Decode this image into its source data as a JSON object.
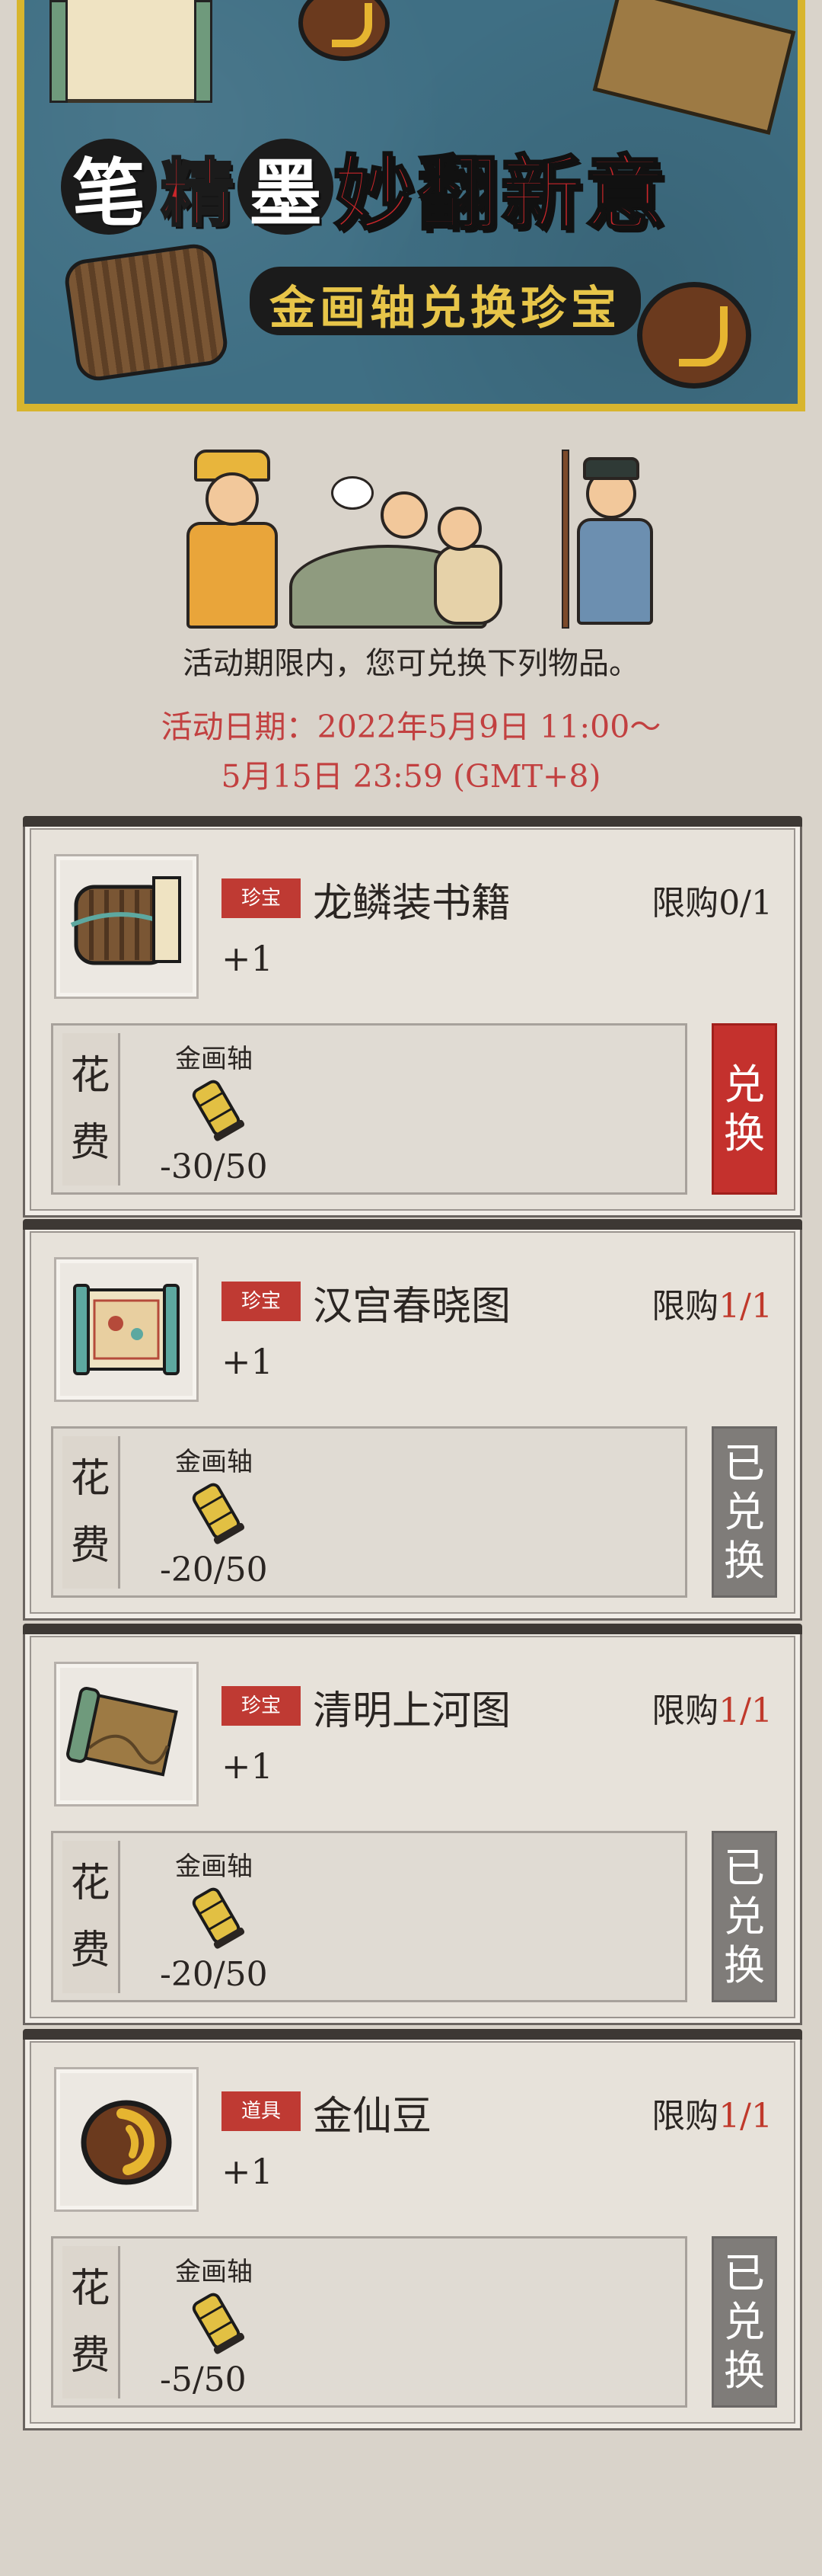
{
  "banner": {
    "title_chars": [
      "笔",
      "精",
      "墨"
    ],
    "title_rest": "妙翻新意",
    "subtitle": "金画轴兑换珍宝"
  },
  "intro": {
    "description": "活动期限内，您可兑换下列物品。",
    "date_line_1": "活动日期：2022年5月9日 11:00～",
    "date_line_2": "5月15日 23:59 (GMT+8)"
  },
  "colors": {
    "accent_red": "#c4312d",
    "disabled_gray": "#7f7c79",
    "banner_blue": "#3f6f84",
    "banner_gold": "#d8b52e"
  },
  "cost_labels": {
    "char_1": "花",
    "char_2": "费"
  },
  "items": [
    {
      "tag": "珍宝",
      "name": "龙鳞装书籍",
      "limit_prefix": "限购",
      "limit_value": "0/1",
      "qty": "+1",
      "cost_item": "金画轴",
      "cost": "-30/50",
      "button": [
        "兑",
        "换"
      ],
      "button_state": "active",
      "icon": "scroll-bundle-icon"
    },
    {
      "tag": "珍宝",
      "name": "汉宫春晓图",
      "limit_prefix": "限购",
      "limit_value": "1/1",
      "qty": "+1",
      "cost_item": "金画轴",
      "cost": "-20/50",
      "button": [
        "已",
        "兑",
        "换"
      ],
      "button_state": "done",
      "icon": "painting-scroll-icon"
    },
    {
      "tag": "珍宝",
      "name": "清明上河图",
      "limit_prefix": "限购",
      "limit_value": "1/1",
      "qty": "+1",
      "cost_item": "金画轴",
      "cost": "-20/50",
      "button": [
        "已",
        "兑",
        "换"
      ],
      "button_state": "done",
      "icon": "landscape-scroll-icon"
    },
    {
      "tag": "道具",
      "name": "金仙豆",
      "limit_prefix": "限购",
      "limit_value": "1/1",
      "qty": "+1",
      "cost_item": "金画轴",
      "cost": "-5/50",
      "button": [
        "已",
        "兑",
        "换"
      ],
      "button_state": "done",
      "icon": "golden-bean-icon"
    }
  ]
}
